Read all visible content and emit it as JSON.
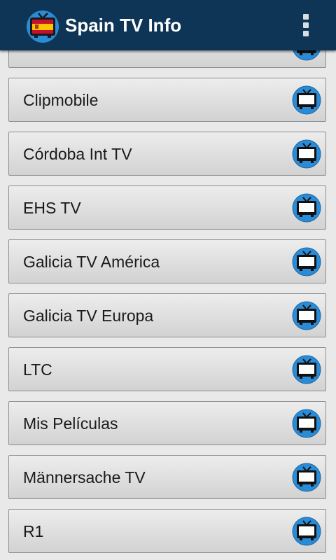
{
  "app": {
    "title": "Spain TV Info",
    "icon": "tv-flag-icon",
    "menu_icon": "overflow-menu-icon"
  },
  "colors": {
    "toolbar": "#0e3556",
    "icon_circle": "#2a8bd6",
    "row_border": "#8d8d8d"
  },
  "channels": [
    {
      "label": "",
      "icon": "tv-icon"
    },
    {
      "label": "Clipmobile",
      "icon": "tv-icon"
    },
    {
      "label": "Córdoba Int TV",
      "icon": "tv-icon"
    },
    {
      "label": "EHS TV",
      "icon": "tv-icon"
    },
    {
      "label": "Galicia TV América",
      "icon": "tv-icon"
    },
    {
      "label": "Galicia TV Europa",
      "icon": "tv-icon"
    },
    {
      "label": "LTC",
      "icon": "tv-icon"
    },
    {
      "label": "Mis Películas",
      "icon": "tv-icon"
    },
    {
      "label": "Männersache TV",
      "icon": "tv-icon"
    },
    {
      "label": "R1",
      "icon": "tv-icon"
    }
  ]
}
